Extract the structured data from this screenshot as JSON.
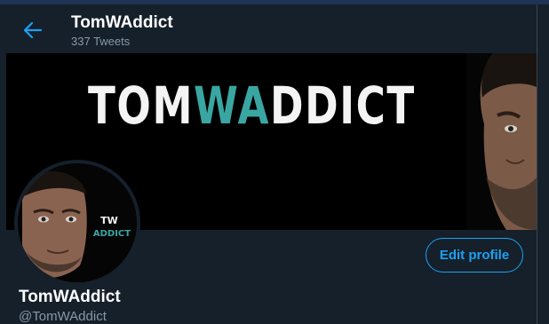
{
  "header": {
    "title": "TomWAddict",
    "tweet_count": "337 Tweets",
    "back_icon": "arrow-left-icon"
  },
  "banner": {
    "word_main": "TOM",
    "word_accent": "WA",
    "word_tail": "DDICT"
  },
  "avatar": {
    "logo_line1": "TW",
    "logo_line2": "ADDICT"
  },
  "profile": {
    "name": "TomWAddict",
    "handle": "@TomWAddict",
    "edit_label": "Edit profile"
  },
  "colors": {
    "background": "#15202b",
    "accent": "#1da1f2",
    "secondary_text": "#8899a6",
    "logo_teal": "#3aa6a2"
  }
}
